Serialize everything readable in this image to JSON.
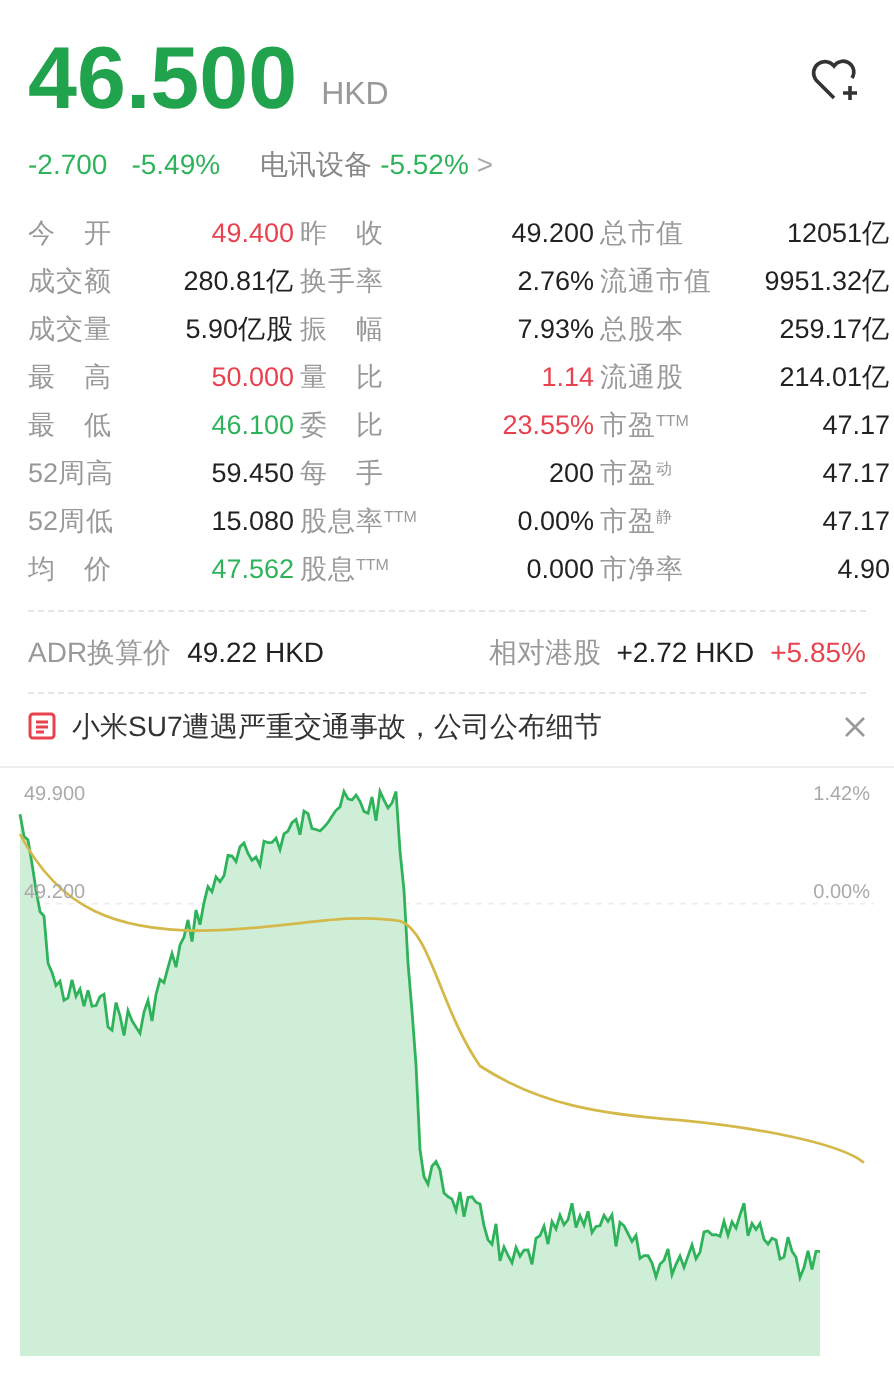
{
  "quote": {
    "price": "46.500",
    "currency": "HKD",
    "change": "-2.700",
    "change_pct": "-5.49%",
    "sector": "电讯设备",
    "sector_pct": "-5.52%",
    "sector_arrow": ">",
    "favorite": false
  },
  "stats": [
    [
      {
        "label": "今 开",
        "value": "49.400",
        "color": "#e8424f"
      },
      {
        "label": "昨 收",
        "value": "49.200",
        "color": "#222222"
      },
      {
        "label": "总市值",
        "value": "12051亿",
        "color": "#222222"
      }
    ],
    [
      {
        "label": "成交额",
        "value": "280.81亿",
        "color": "#222222"
      },
      {
        "label": "换手率",
        "value": "2.76%",
        "color": "#222222"
      },
      {
        "label": "流通市值",
        "value": "9951.32亿",
        "color": "#222222"
      }
    ],
    [
      {
        "label": "成交量",
        "value": "5.90亿股",
        "color": "#222222"
      },
      {
        "label": "振 幅",
        "value": "7.93%",
        "color": "#222222"
      },
      {
        "label": "总股本",
        "value": "259.17亿",
        "color": "#222222"
      }
    ],
    [
      {
        "label": "最 高",
        "value": "50.000",
        "color": "#e8424f"
      },
      {
        "label": "量 比",
        "value": "1.14",
        "color": "#e8424f"
      },
      {
        "label": "流通股",
        "value": "214.01亿",
        "color": "#222222"
      }
    ],
    [
      {
        "label": "最 低",
        "value": "46.100",
        "color": "#2fb35a"
      },
      {
        "label": "委 比",
        "value": "23.55%",
        "color": "#e8424f"
      },
      {
        "label": "市盈$^{TTM}$",
        "value": "47.17",
        "color": "#222222"
      }
    ],
    [
      {
        "label": "52周高",
        "value": "59.450",
        "color": "#222222"
      },
      {
        "label": "每 手",
        "value": "200",
        "color": "#222222"
      },
      {
        "label": "市盈$^{动}$",
        "value": "47.17",
        "color": "#222222"
      }
    ],
    [
      {
        "label": "52周低",
        "value": "15.080",
        "color": "#222222"
      },
      {
        "label": "股息率$^{TTM}$",
        "value": "0.00%",
        "color": "#222222"
      },
      {
        "label": "市盈$^{静}$",
        "value": "47.17",
        "color": "#222222"
      }
    ],
    [
      {
        "label": "均 价",
        "value": "47.562",
        "color": "#2fb35a"
      },
      {
        "label": "股息$^{TTM}$",
        "value": "0.000",
        "color": "#222222"
      },
      {
        "label": "市净率",
        "value": "4.90",
        "color": "#222222"
      }
    ]
  ],
  "adr": {
    "label": "ADR换算价",
    "value": "49.22 HKD",
    "relative_label": "相对港股",
    "relative_value": "+2.72 HKD",
    "relative_pct": "+5.85%"
  },
  "news": {
    "headline": "小米SU7遭遇严重交通事故，公司公布细节"
  },
  "chart": {
    "price_labels": [
      "49.900",
      "49.200"
    ],
    "pct_labels": [
      "1.42%",
      "0.00%"
    ]
  }
}
